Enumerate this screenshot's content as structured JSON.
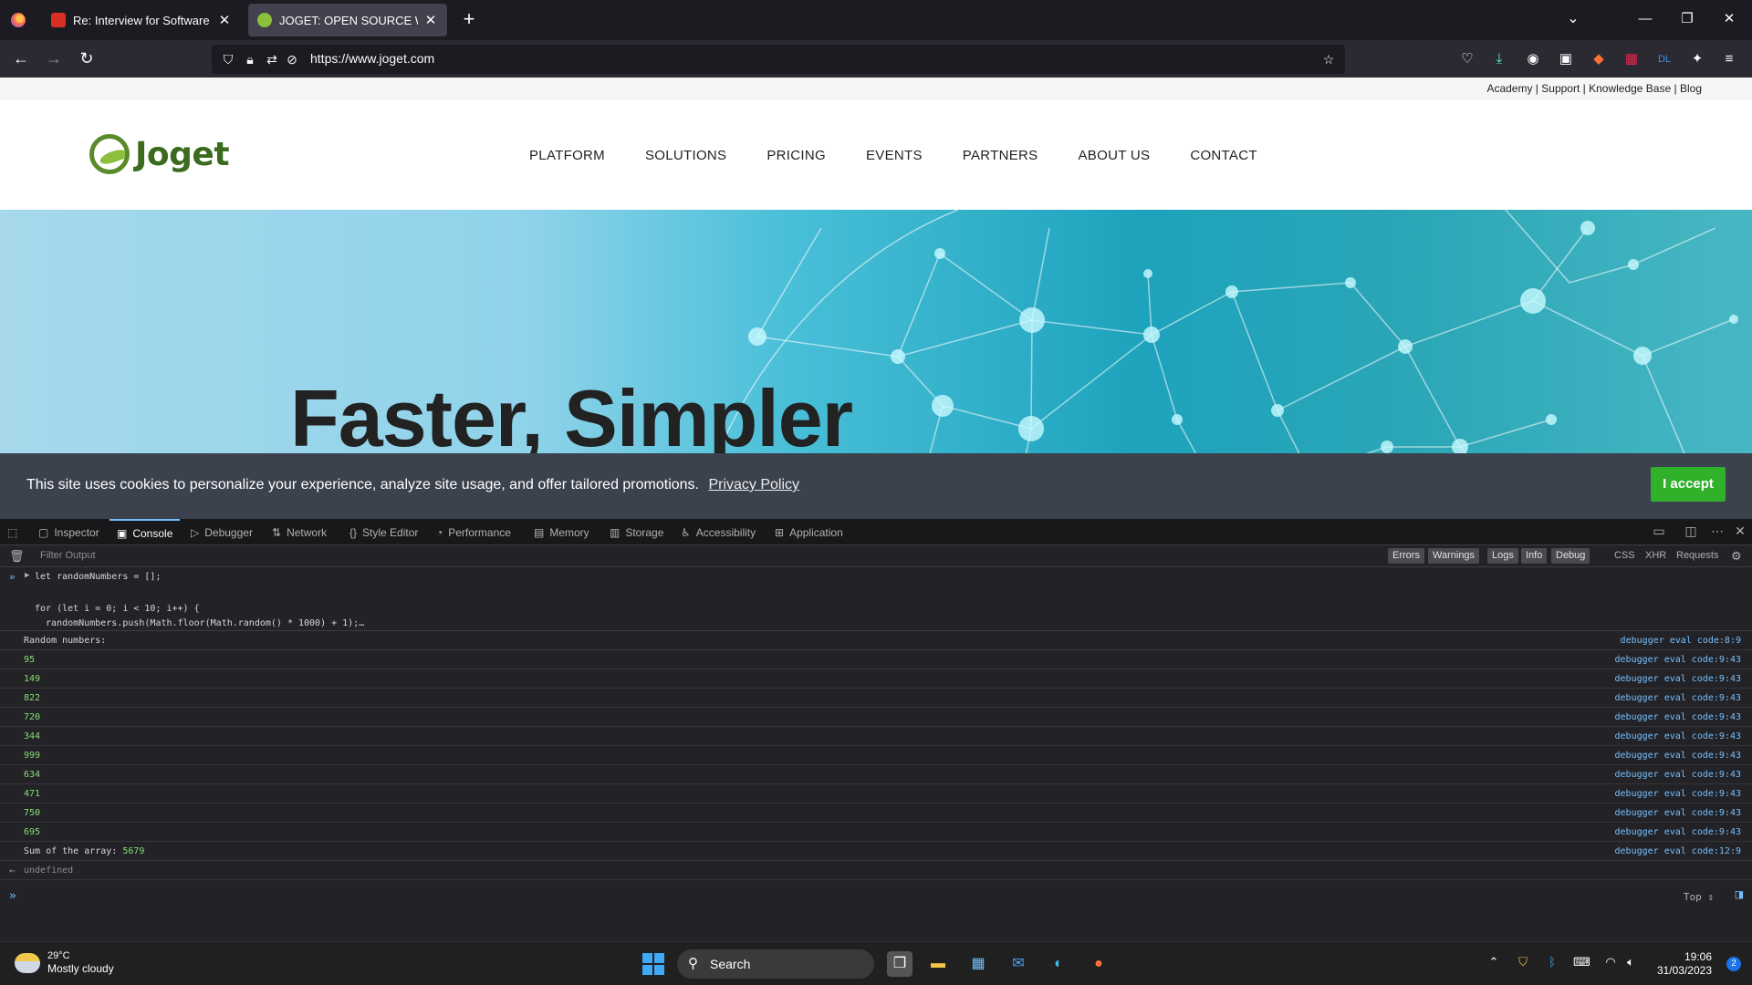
{
  "browser": {
    "tabs": [
      {
        "title": "Re: Interview for Software Engin",
        "active": false
      },
      {
        "title": "JOGET: OPEN SOURCE WORKFL",
        "active": true
      }
    ],
    "new_tab": "+",
    "url_host": "https://www.joget.com"
  },
  "site": {
    "utility_links": [
      "Academy",
      "Support",
      "Knowledge Base",
      "Blog"
    ],
    "utility_sep": " | ",
    "logo_text": "Joget",
    "nav": [
      "PLATFORM",
      "SOLUTIONS",
      "PRICING",
      "EVENTS",
      "PARTNERS",
      "ABOUT US",
      "CONTACT"
    ],
    "hero_title": "Faster, Simpler",
    "cookie": {
      "message": "This site uses cookies to personalize your experience, analyze site usage, and offer tailored promotions.",
      "policy_link": "Privacy Policy",
      "accept": "I accept"
    }
  },
  "devtools": {
    "tabs": [
      "Inspector",
      "Console",
      "Debugger",
      "Network",
      "Style Editor",
      "Performance",
      "Memory",
      "Storage",
      "Accessibility",
      "Application"
    ],
    "active_tab": "Console",
    "filter_placeholder": "Filter Output",
    "levels": [
      "Errors",
      "Warnings",
      "Logs",
      "Info",
      "Debug"
    ],
    "extra_filters": [
      "CSS",
      "XHR",
      "Requests"
    ],
    "command": {
      "line1": "let randomNumbers = [];",
      "line2": "for (let i = 0; i < 10; i++) {",
      "line3": "  randomNumbers.push(Math.floor(Math.random() * 1000) + 1);…"
    },
    "log_header": {
      "text": "Random numbers:",
      "source": "debugger eval code:8:9"
    },
    "numbers": [
      "95",
      "149",
      "822",
      "720",
      "344",
      "999",
      "634",
      "471",
      "750",
      "695"
    ],
    "number_source": "debugger eval code:9:43",
    "sum": {
      "label": "Sum of the array: ",
      "value": "5679",
      "source": "debugger eval code:12:9"
    },
    "return_value": "undefined",
    "context": "Top ⇕"
  },
  "taskbar": {
    "weather_temp": "29°C",
    "weather_desc": "Mostly cloudy",
    "search_label": "Search",
    "time": "19:06",
    "date": "31/03/2023",
    "notifications": "2"
  },
  "colors": {
    "cookie_bg": "#3b424e",
    "accept_green": "#2fb12a",
    "logo_green": "#3c6b1f",
    "devtools_bg": "#232327",
    "link_blue": "#75bfff",
    "number_green": "#86de74"
  }
}
